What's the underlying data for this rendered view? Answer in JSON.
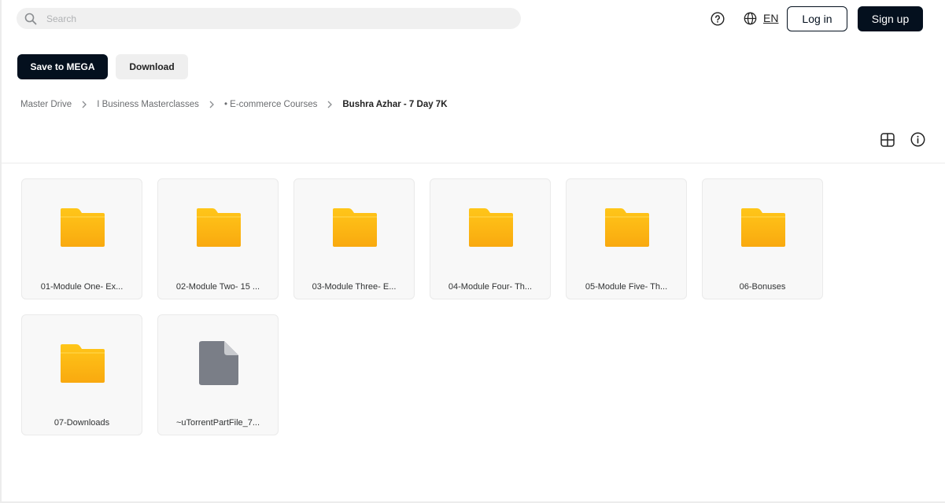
{
  "search": {
    "placeholder": "Search",
    "value": ""
  },
  "header": {
    "help_icon": "help-icon",
    "language_code": "EN",
    "login_label": "Log in",
    "signup_label": "Sign up"
  },
  "actions": {
    "save_label": "Save to MEGA",
    "download_label": "Download"
  },
  "breadcrumb": {
    "items": [
      "Master Drive",
      "I Business Masterclasses",
      "• E-commerce Courses"
    ],
    "current": "Bushra Azhar - 7 Day 7K"
  },
  "items": [
    {
      "name": "01-Module One- Ex...",
      "type": "folder"
    },
    {
      "name": "02-Module Two- 15 ...",
      "type": "folder"
    },
    {
      "name": "03-Module Three- E...",
      "type": "folder"
    },
    {
      "name": "04-Module Four- Th...",
      "type": "folder"
    },
    {
      "name": "05-Module Five- Th...",
      "type": "folder"
    },
    {
      "name": "06-Bonuses",
      "type": "folder"
    },
    {
      "name": "07-Downloads",
      "type": "folder"
    },
    {
      "name": "~uTorrentPartFile_7...",
      "type": "file"
    }
  ],
  "colors": {
    "primary": "#04101e",
    "folder_top": "#ffc619",
    "folder_bottom": "#f9a90f",
    "file": "#7a7e87"
  }
}
